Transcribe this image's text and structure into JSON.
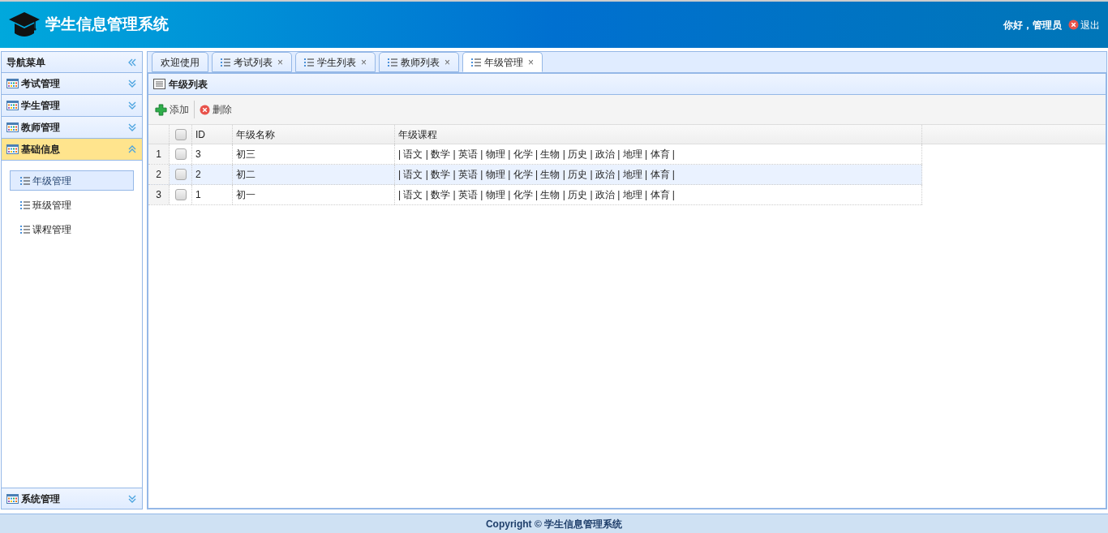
{
  "header": {
    "title": "学生信息管理系统",
    "greeting": "你好，管理员",
    "logout": "退出"
  },
  "sidebar": {
    "title": "导航菜单",
    "sections": [
      {
        "label": "考试管理",
        "expanded": false
      },
      {
        "label": "学生管理",
        "expanded": false
      },
      {
        "label": "教师管理",
        "expanded": false
      },
      {
        "label": "基础信息",
        "expanded": true,
        "items": [
          {
            "label": "年级管理",
            "selected": true
          },
          {
            "label": "班级管理",
            "selected": false
          },
          {
            "label": "课程管理",
            "selected": false
          }
        ]
      }
    ],
    "bottom_section": {
      "label": "系统管理",
      "expanded": false
    }
  },
  "tabs": [
    {
      "label": "欢迎使用",
      "selected": false
    },
    {
      "label": "考试列表",
      "selected": false,
      "close": "×"
    },
    {
      "label": "学生列表",
      "selected": false,
      "close": "×"
    },
    {
      "label": "教师列表",
      "selected": false,
      "close": "×"
    },
    {
      "label": "年级管理",
      "selected": true,
      "close": "×"
    }
  ],
  "panel": {
    "title": "年级列表",
    "toolbar": [
      {
        "kind": "add",
        "label": "添加"
      },
      {
        "kind": "delete",
        "label": "删除"
      }
    ],
    "table": {
      "columns": [
        "ID",
        "年级名称",
        "年级课程"
      ],
      "all_checked": false,
      "rows": [
        {
          "number": "1",
          "checked": false,
          "highlighted": false,
          "cells": [
            "3",
            "初三",
            "| 语文 | 数学 | 英语 | 物理 | 化学 | 生物 | 历史 | 政治 | 地理 | 体育 |"
          ]
        },
        {
          "number": "2",
          "checked": false,
          "highlighted": true,
          "cells": [
            "2",
            "初二",
            "| 语文 | 数学 | 英语 | 物理 | 化学 | 生物 | 历史 | 政治 | 地理 | 体育 |"
          ]
        },
        {
          "number": "3",
          "checked": false,
          "highlighted": false,
          "cells": [
            "1",
            "初一",
            "| 语文 | 数学 | 英语 | 物理 | 化学 | 生物 | 历史 | 政治 | 地理 | 体育 |"
          ]
        }
      ]
    }
  },
  "footer": "Copyright © 学生信息管理系统"
}
